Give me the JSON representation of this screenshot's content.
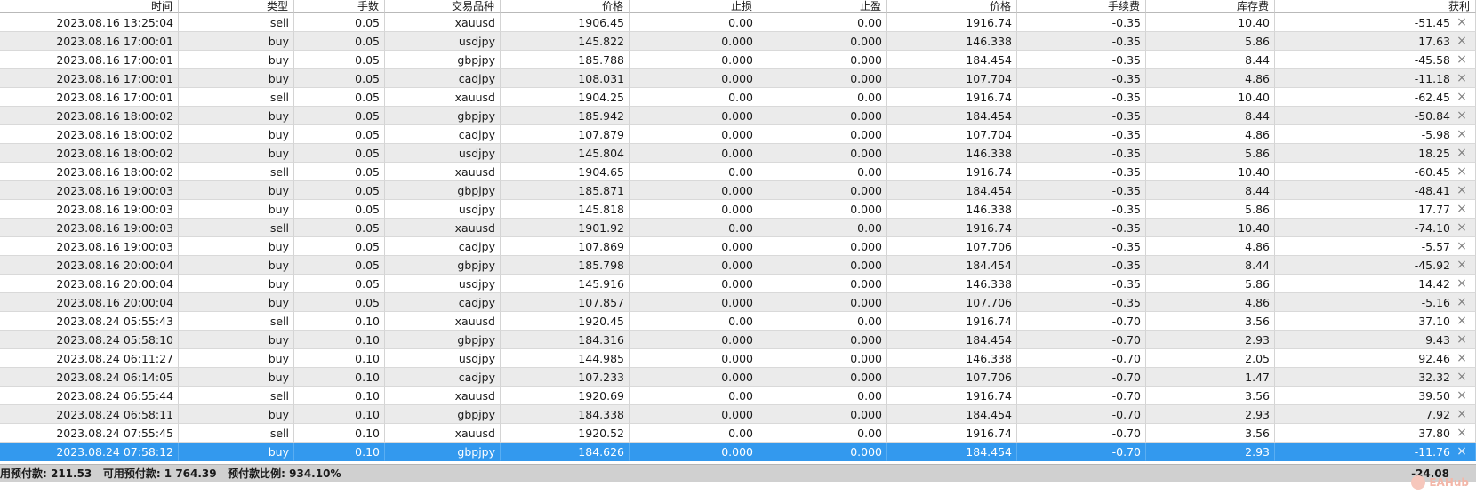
{
  "table": {
    "columns": [
      "时间",
      "类型",
      "手数",
      "交易品种",
      "价格",
      "止损",
      "止盈",
      "价格",
      "手续费",
      "库存费",
      "获利"
    ],
    "rows": [
      [
        "2023.08.16 13:25:04",
        "sell",
        "0.05",
        "xauusd",
        "1906.45",
        "0.00",
        "0.00",
        "1916.74",
        "-0.35",
        "10.40",
        "-51.45"
      ],
      [
        "2023.08.16 17:00:01",
        "buy",
        "0.05",
        "usdjpy",
        "145.822",
        "0.000",
        "0.000",
        "146.338",
        "-0.35",
        "5.86",
        "17.63"
      ],
      [
        "2023.08.16 17:00:01",
        "buy",
        "0.05",
        "gbpjpy",
        "185.788",
        "0.000",
        "0.000",
        "184.454",
        "-0.35",
        "8.44",
        "-45.58"
      ],
      [
        "2023.08.16 17:00:01",
        "buy",
        "0.05",
        "cadjpy",
        "108.031",
        "0.000",
        "0.000",
        "107.704",
        "-0.35",
        "4.86",
        "-11.18"
      ],
      [
        "2023.08.16 17:00:01",
        "sell",
        "0.05",
        "xauusd",
        "1904.25",
        "0.00",
        "0.00",
        "1916.74",
        "-0.35",
        "10.40",
        "-62.45"
      ],
      [
        "2023.08.16 18:00:02",
        "buy",
        "0.05",
        "gbpjpy",
        "185.942",
        "0.000",
        "0.000",
        "184.454",
        "-0.35",
        "8.44",
        "-50.84"
      ],
      [
        "2023.08.16 18:00:02",
        "buy",
        "0.05",
        "cadjpy",
        "107.879",
        "0.000",
        "0.000",
        "107.704",
        "-0.35",
        "4.86",
        "-5.98"
      ],
      [
        "2023.08.16 18:00:02",
        "buy",
        "0.05",
        "usdjpy",
        "145.804",
        "0.000",
        "0.000",
        "146.338",
        "-0.35",
        "5.86",
        "18.25"
      ],
      [
        "2023.08.16 18:00:02",
        "sell",
        "0.05",
        "xauusd",
        "1904.65",
        "0.00",
        "0.00",
        "1916.74",
        "-0.35",
        "10.40",
        "-60.45"
      ],
      [
        "2023.08.16 19:00:03",
        "buy",
        "0.05",
        "gbpjpy",
        "185.871",
        "0.000",
        "0.000",
        "184.454",
        "-0.35",
        "8.44",
        "-48.41"
      ],
      [
        "2023.08.16 19:00:03",
        "buy",
        "0.05",
        "usdjpy",
        "145.818",
        "0.000",
        "0.000",
        "146.338",
        "-0.35",
        "5.86",
        "17.77"
      ],
      [
        "2023.08.16 19:00:03",
        "sell",
        "0.05",
        "xauusd",
        "1901.92",
        "0.00",
        "0.00",
        "1916.74",
        "-0.35",
        "10.40",
        "-74.10"
      ],
      [
        "2023.08.16 19:00:03",
        "buy",
        "0.05",
        "cadjpy",
        "107.869",
        "0.000",
        "0.000",
        "107.706",
        "-0.35",
        "4.86",
        "-5.57"
      ],
      [
        "2023.08.16 20:00:04",
        "buy",
        "0.05",
        "gbpjpy",
        "185.798",
        "0.000",
        "0.000",
        "184.454",
        "-0.35",
        "8.44",
        "-45.92"
      ],
      [
        "2023.08.16 20:00:04",
        "buy",
        "0.05",
        "usdjpy",
        "145.916",
        "0.000",
        "0.000",
        "146.338",
        "-0.35",
        "5.86",
        "14.42"
      ],
      [
        "2023.08.16 20:00:04",
        "buy",
        "0.05",
        "cadjpy",
        "107.857",
        "0.000",
        "0.000",
        "107.706",
        "-0.35",
        "4.86",
        "-5.16"
      ],
      [
        "2023.08.24 05:55:43",
        "sell",
        "0.10",
        "xauusd",
        "1920.45",
        "0.00",
        "0.00",
        "1916.74",
        "-0.70",
        "3.56",
        "37.10"
      ],
      [
        "2023.08.24 05:58:10",
        "buy",
        "0.10",
        "gbpjpy",
        "184.316",
        "0.000",
        "0.000",
        "184.454",
        "-0.70",
        "2.93",
        "9.43"
      ],
      [
        "2023.08.24 06:11:27",
        "buy",
        "0.10",
        "usdjpy",
        "144.985",
        "0.000",
        "0.000",
        "146.338",
        "-0.70",
        "2.05",
        "92.46"
      ],
      [
        "2023.08.24 06:14:05",
        "buy",
        "0.10",
        "cadjpy",
        "107.233",
        "0.000",
        "0.000",
        "107.706",
        "-0.70",
        "1.47",
        "32.32"
      ],
      [
        "2023.08.24 06:55:44",
        "sell",
        "0.10",
        "xauusd",
        "1920.69",
        "0.00",
        "0.00",
        "1916.74",
        "-0.70",
        "3.56",
        "39.50"
      ],
      [
        "2023.08.24 06:58:11",
        "buy",
        "0.10",
        "gbpjpy",
        "184.338",
        "0.000",
        "0.000",
        "184.454",
        "-0.70",
        "2.93",
        "7.92"
      ],
      [
        "2023.08.24 07:55:45",
        "sell",
        "0.10",
        "xauusd",
        "1920.52",
        "0.00",
        "0.00",
        "1916.74",
        "-0.70",
        "3.56",
        "37.80"
      ],
      [
        "2023.08.24 07:58:12",
        "buy",
        "0.10",
        "gbpjpy",
        "184.626",
        "0.000",
        "0.000",
        "184.454",
        "-0.70",
        "2.93",
        "-11.76"
      ]
    ],
    "selected_row": 23,
    "close_glyph": "×"
  },
  "status": {
    "text": "用预付款: 211.53   可用预付款: 1 764.39   预付款比例: 934.10%",
    "total": "-24.08"
  },
  "watermark": "EAHub",
  "colors": {
    "selected_row": "#3399ee",
    "alt_row": "#ebebeb",
    "status_bar": "#d0d0d0"
  }
}
